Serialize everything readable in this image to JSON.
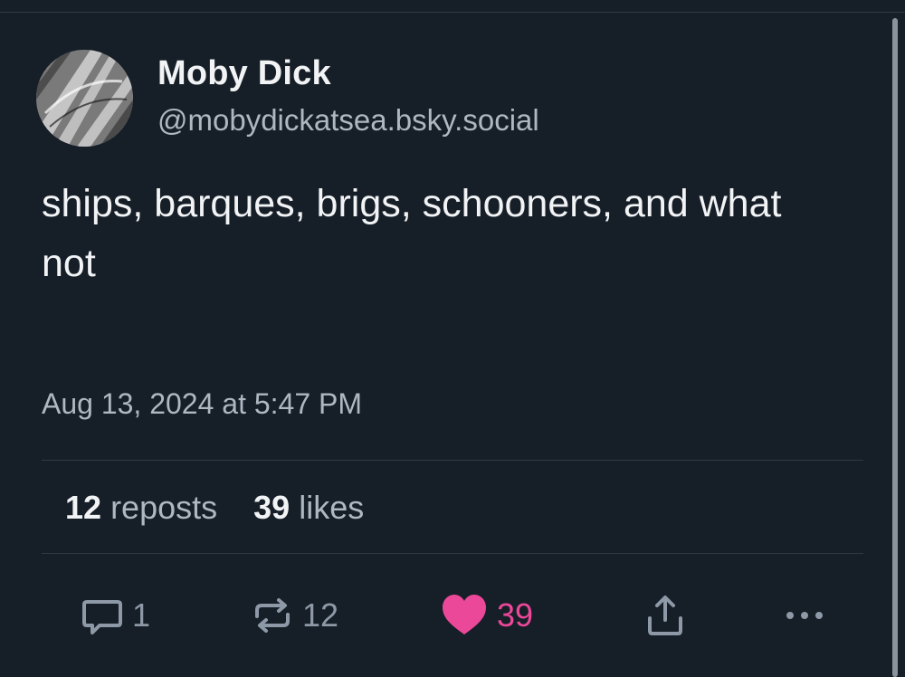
{
  "author": {
    "display_name": "Moby Dick",
    "handle": "@mobydickatsea.bsky.social"
  },
  "post": {
    "text": "ships, barques, brigs, schooners, and what not",
    "timestamp": "Aug 13, 2024 at 5:47 PM"
  },
  "stats": {
    "reposts_count": "12",
    "reposts_label": "reposts",
    "likes_count": "39",
    "likes_label": "likes"
  },
  "actions": {
    "reply_count": "1",
    "repost_count": "12",
    "like_count": "39",
    "liked": true
  },
  "colors": {
    "background": "#161e27",
    "text_primary": "#f1f3f5",
    "text_secondary": "#aeb7c2",
    "icon": "#8e99a7",
    "like_accent": "#ec4899",
    "divider": "#2e3845"
  },
  "icons": {
    "reply": "speech-bubble-icon",
    "repost": "repost-arrows-icon",
    "like": "heart-icon",
    "share": "share-upload-icon",
    "more": "ellipsis-icon"
  }
}
